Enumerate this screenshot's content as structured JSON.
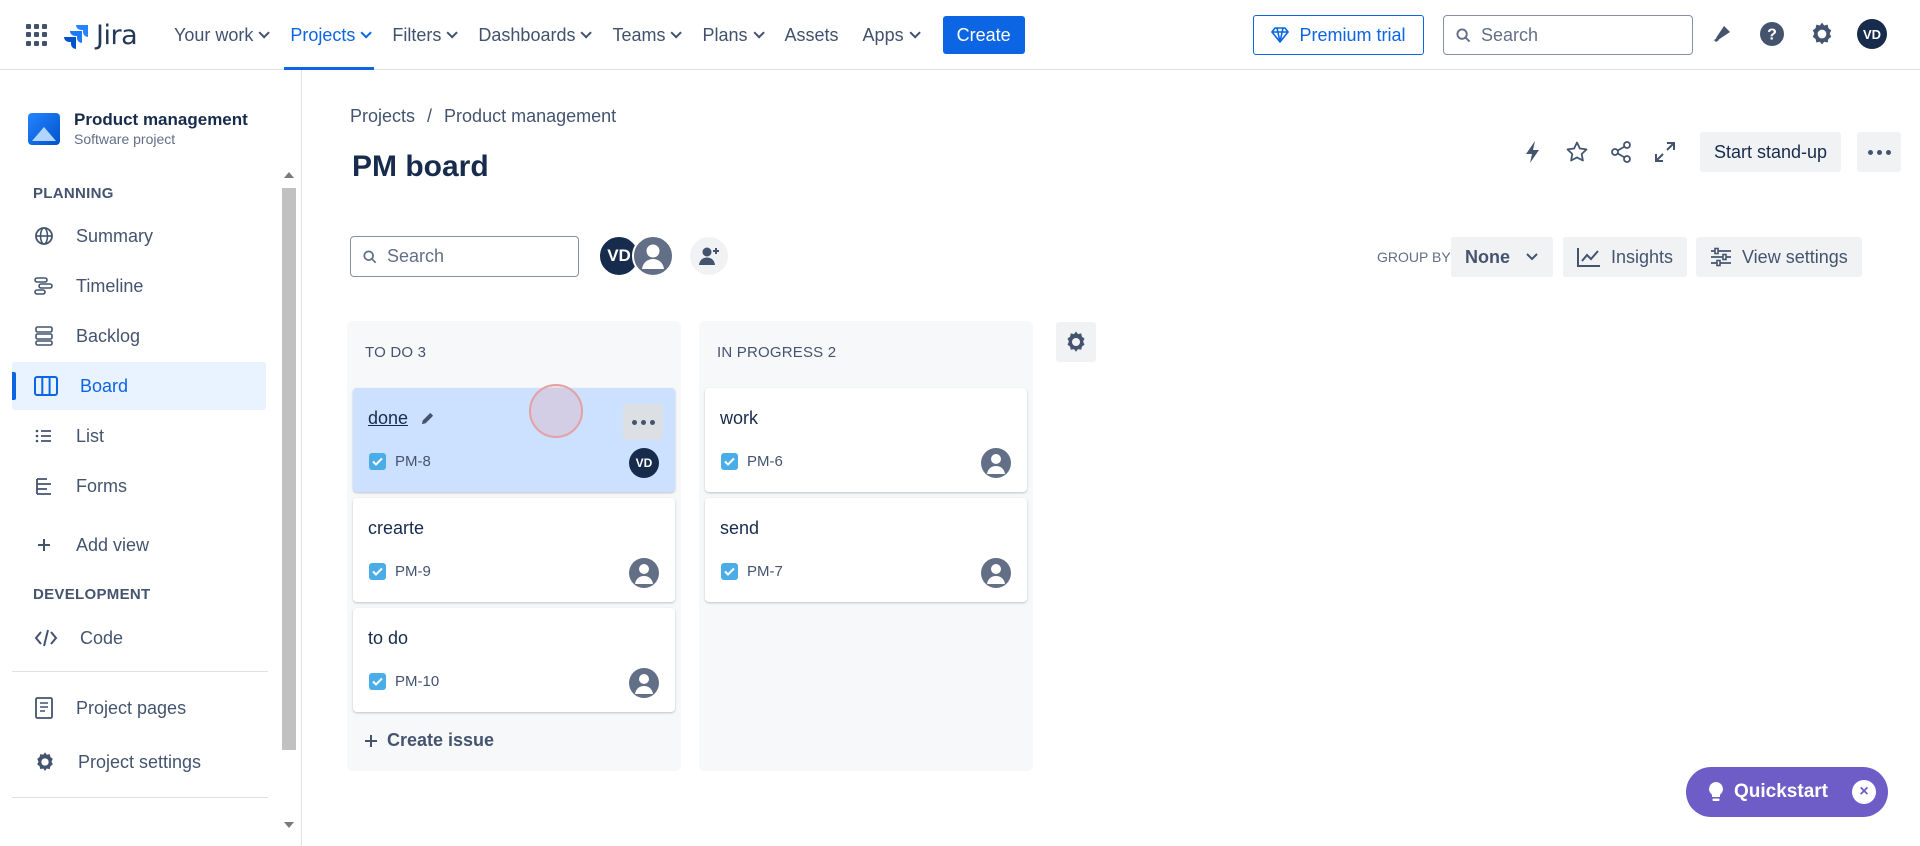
{
  "nav": {
    "logo_text": "Jira",
    "items": [
      {
        "label": "Your work",
        "chevron": true,
        "active": false
      },
      {
        "label": "Projects",
        "chevron": true,
        "active": true
      },
      {
        "label": "Filters",
        "chevron": true,
        "active": false
      },
      {
        "label": "Dashboards",
        "chevron": true,
        "active": false
      },
      {
        "label": "Teams",
        "chevron": true,
        "active": false
      },
      {
        "label": "Plans",
        "chevron": true,
        "active": false
      },
      {
        "label": "Assets",
        "chevron": false,
        "active": false
      },
      {
        "label": "Apps",
        "chevron": true,
        "active": false
      }
    ],
    "create_label": "Create",
    "premium_label": "Premium trial",
    "search_placeholder": "Search",
    "user_initials": "VD",
    "accent": "#0c66e4"
  },
  "sidebar": {
    "project_name": "Product management",
    "project_type": "Software project",
    "planning_label": "PLANNING",
    "items": [
      {
        "label": "Summary",
        "icon": "globe-icon"
      },
      {
        "label": "Timeline",
        "icon": "timeline-icon"
      },
      {
        "label": "Backlog",
        "icon": "backlog-icon"
      },
      {
        "label": "Board",
        "icon": "board-icon",
        "active": true
      },
      {
        "label": "List",
        "icon": "list-icon"
      },
      {
        "label": "Forms",
        "icon": "forms-icon"
      },
      {
        "label": "Add view",
        "icon": "plus-icon"
      }
    ],
    "development_label": "DEVELOPMENT",
    "code_label": "Code",
    "project_pages_label": "Project pages",
    "project_settings_label": "Project settings"
  },
  "main": {
    "breadcrumb": [
      "Projects",
      "/",
      "Product management"
    ],
    "title": "PM board",
    "standup_label": "Start stand-up",
    "search_placeholder": "Search",
    "avatar_initials": "VD",
    "group_by_label": "GROUP BY",
    "group_by_value": "None",
    "insights_label": "Insights",
    "view_settings_label": "View settings"
  },
  "board": {
    "columns": [
      {
        "title": "TO DO 3",
        "cards": [
          {
            "summary": "done",
            "key": "PM-8",
            "assignee": "VD"
          },
          {
            "summary": "crearte",
            "key": "PM-9",
            "assignee": ""
          },
          {
            "summary": "to do",
            "key": "PM-10",
            "assignee": ""
          }
        ],
        "create_label": "Create issue"
      },
      {
        "title": "IN PROGRESS 2",
        "cards": [
          {
            "summary": "work",
            "key": "PM-6",
            "assignee": ""
          },
          {
            "summary": "send",
            "key": "PM-7",
            "assignee": ""
          }
        ]
      }
    ]
  },
  "quickstart": {
    "label": "Quickstart",
    "close": "×",
    "color": "#6e5dc6"
  }
}
